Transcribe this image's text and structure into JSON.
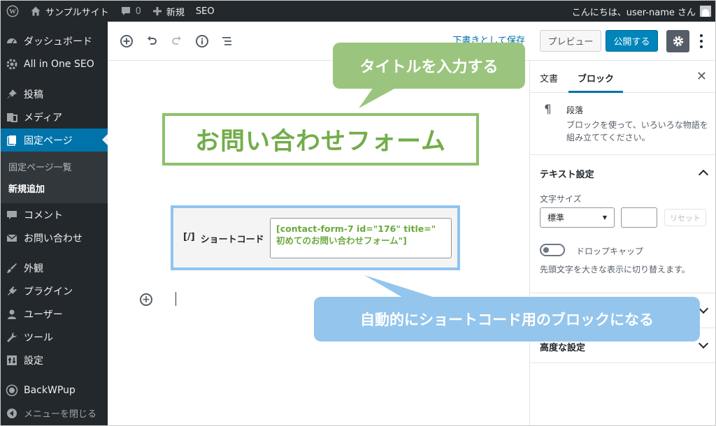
{
  "admin_bar": {
    "site_name": "サンプルサイト",
    "comments_count": "0",
    "new_label": "新規",
    "seo_label": "SEO",
    "greeting": "こんにちは、user-name さん"
  },
  "sidebar": {
    "items": [
      {
        "label": "ダッシュボード",
        "icon": "dashboard-icon"
      },
      {
        "label": "All in One SEO",
        "icon": "gear-icon"
      },
      {
        "label": "投稿",
        "icon": "pin-icon"
      },
      {
        "label": "メディア",
        "icon": "media-icon"
      },
      {
        "label": "固定ページ",
        "icon": "pages-icon"
      },
      {
        "label": "コメント",
        "icon": "comment-icon"
      },
      {
        "label": "お問い合わせ",
        "icon": "mail-icon"
      },
      {
        "label": "外観",
        "icon": "brush-icon"
      },
      {
        "label": "プラグイン",
        "icon": "plugin-icon"
      },
      {
        "label": "ユーザー",
        "icon": "user-icon"
      },
      {
        "label": "ツール",
        "icon": "wrench-icon"
      },
      {
        "label": "設定",
        "icon": "settings-icon"
      },
      {
        "label": "BackWPup",
        "icon": "backwpup-icon"
      },
      {
        "label": "メニューを閉じる",
        "icon": "collapse-icon"
      }
    ],
    "submenu": [
      "固定ページ一覧",
      "新規追加"
    ]
  },
  "editor": {
    "save_draft": "下書きとして保存",
    "page_title": "お問い合わせフォーム",
    "shortcode_label": "ショートコード",
    "shortcode_icon_text": "[/]",
    "shortcode_line1": "[contact-form-7 id=\"176\" title=\"",
    "shortcode_line2": "初めてのお問い合わせフォーム\"]"
  },
  "header": {
    "preview": "プレビュー",
    "publish": "公開する"
  },
  "panel": {
    "tab_document": "文書",
    "tab_block": "ブロック",
    "block_name": "段落",
    "block_desc": "ブロックを使って、いろいろな物語を組み立ててください。",
    "text_settings": "テキスト設定",
    "font_size_label": "文字サイズ",
    "font_size_value": "標準",
    "reset": "リセット",
    "drop_cap": "ドロップキャップ",
    "drop_cap_desc": "先頭文字を大きな表示に切り替えます。",
    "advanced": "高度な設定"
  },
  "callouts": {
    "title_hint": "タイトルを入力する",
    "shortcode_hint": "自動的にショートコード用のブロックになる"
  },
  "colors": {
    "admin_dark": "#23282d",
    "wp_blue": "#0073aa",
    "callout_green": "#9bc57e",
    "callout_blue": "#94c5ec",
    "title_green": "#72ad49"
  }
}
